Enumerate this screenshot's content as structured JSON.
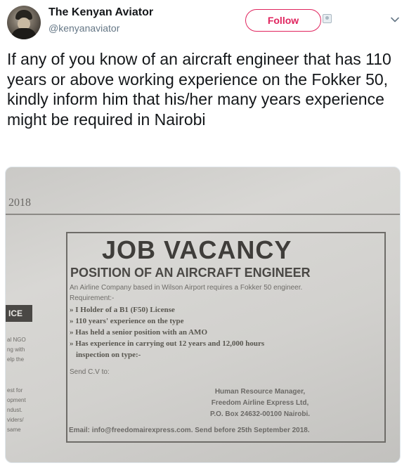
{
  "user": {
    "display_name": "The Kenyan Aviator",
    "handle": "@kenyanaviator"
  },
  "actions": {
    "follow_label": "Follow"
  },
  "tweet": {
    "text": "If any of you know of an aircraft engineer that has 110 years or above working experience on the Fokker 50, kindly inform him that his/her many years experience might be required in Nairobi"
  },
  "image": {
    "year": "2018",
    "side_label": "ICE",
    "side_fragments": [
      "al NGO",
      "ng with",
      "elp the",
      "est for",
      "opment",
      "ndust.",
      "viders/",
      "same"
    ],
    "ad_title": "JOB VACANCY",
    "ad_subtitle": "POSITION OF AN AIRCRAFT ENGINEER",
    "ad_intro": "An Airline Company based in Wilson Airport requires a Fokker 50 engineer.",
    "requirements_label": "Requirement:-",
    "requirements": [
      "» I Holder of a B1 (F50) License",
      "» 110 years' experience on the type",
      "» Has held a senior position with an AMO",
      "» Has experience in carrying out 12 years and 12,000 hours",
      "inspection on type:-"
    ],
    "send_label": "Send C.V to:",
    "contact": [
      "Human Resource Manager,",
      "Freedom Airline Express Ltd,",
      "P.O. Box 24632-00100 Nairobi."
    ],
    "email_line": "Email: info@freedomairexpress.com. Send before 25th September 2018."
  }
}
